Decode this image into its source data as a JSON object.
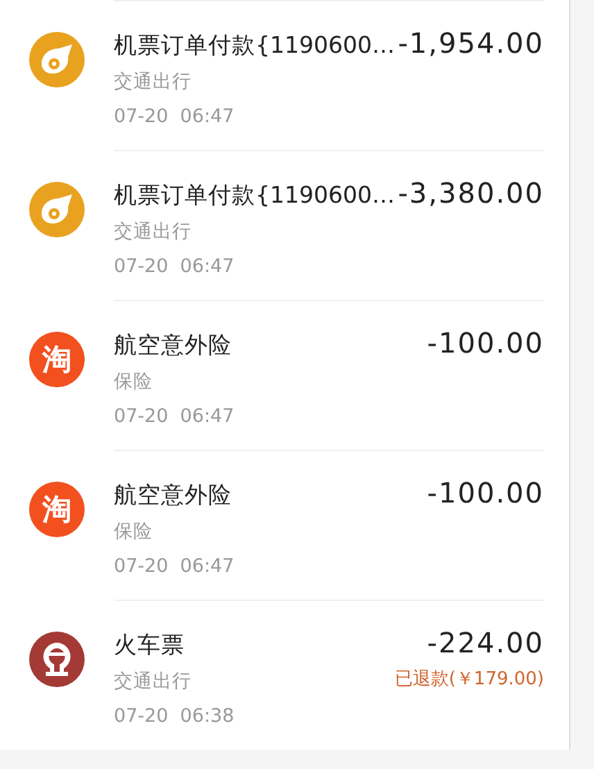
{
  "transactions": [
    {
      "icon": {
        "kind": "plane",
        "color": "#e9a21f"
      },
      "title": "机票订单付款{1190600…",
      "category": "交通出行",
      "time": "07-20  06:47",
      "amount": "-1,954.00"
    },
    {
      "icon": {
        "kind": "plane",
        "color": "#e9a21f"
      },
      "title": "机票订单付款{1190600…",
      "category": "交通出行",
      "time": "07-20  06:47",
      "amount": "-3,380.00"
    },
    {
      "icon": {
        "kind": "glyph",
        "color": "#f2501f",
        "glyph": "淘"
      },
      "title": "航空意外险",
      "category": "保险",
      "time": "07-20  06:47",
      "amount": "-100.00"
    },
    {
      "icon": {
        "kind": "glyph",
        "color": "#f2501f",
        "glyph": "淘"
      },
      "title": "航空意外险",
      "category": "保险",
      "time": "07-20  06:47",
      "amount": "-100.00"
    },
    {
      "icon": {
        "kind": "rail",
        "color": "#a33a36"
      },
      "title": "火车票",
      "category": "交通出行",
      "time": "07-20  06:38",
      "amount": "-224.00",
      "note": "已退款(￥179.00)"
    }
  ]
}
